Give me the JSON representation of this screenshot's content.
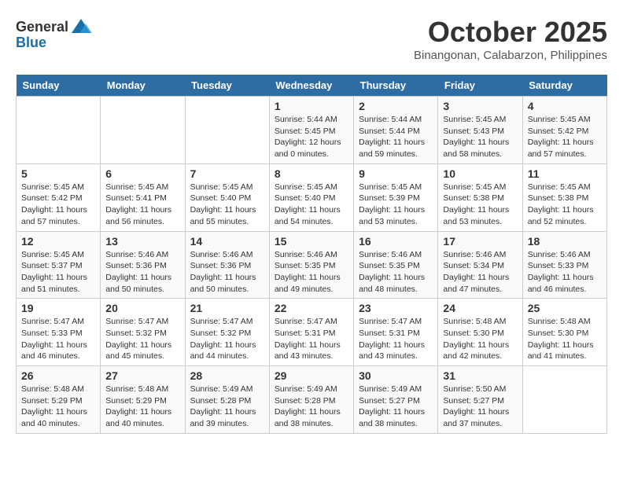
{
  "header": {
    "logo_general": "General",
    "logo_blue": "Blue",
    "month": "October 2025",
    "location": "Binangonan, Calabarzon, Philippines"
  },
  "days_of_week": [
    "Sunday",
    "Monday",
    "Tuesday",
    "Wednesday",
    "Thursday",
    "Friday",
    "Saturday"
  ],
  "weeks": [
    [
      {
        "day": "",
        "info": ""
      },
      {
        "day": "",
        "info": ""
      },
      {
        "day": "",
        "info": ""
      },
      {
        "day": "1",
        "info": "Sunrise: 5:44 AM\nSunset: 5:45 PM\nDaylight: 12 hours\nand 0 minutes."
      },
      {
        "day": "2",
        "info": "Sunrise: 5:44 AM\nSunset: 5:44 PM\nDaylight: 11 hours\nand 59 minutes."
      },
      {
        "day": "3",
        "info": "Sunrise: 5:45 AM\nSunset: 5:43 PM\nDaylight: 11 hours\nand 58 minutes."
      },
      {
        "day": "4",
        "info": "Sunrise: 5:45 AM\nSunset: 5:42 PM\nDaylight: 11 hours\nand 57 minutes."
      }
    ],
    [
      {
        "day": "5",
        "info": "Sunrise: 5:45 AM\nSunset: 5:42 PM\nDaylight: 11 hours\nand 57 minutes."
      },
      {
        "day": "6",
        "info": "Sunrise: 5:45 AM\nSunset: 5:41 PM\nDaylight: 11 hours\nand 56 minutes."
      },
      {
        "day": "7",
        "info": "Sunrise: 5:45 AM\nSunset: 5:40 PM\nDaylight: 11 hours\nand 55 minutes."
      },
      {
        "day": "8",
        "info": "Sunrise: 5:45 AM\nSunset: 5:40 PM\nDaylight: 11 hours\nand 54 minutes."
      },
      {
        "day": "9",
        "info": "Sunrise: 5:45 AM\nSunset: 5:39 PM\nDaylight: 11 hours\nand 53 minutes."
      },
      {
        "day": "10",
        "info": "Sunrise: 5:45 AM\nSunset: 5:38 PM\nDaylight: 11 hours\nand 53 minutes."
      },
      {
        "day": "11",
        "info": "Sunrise: 5:45 AM\nSunset: 5:38 PM\nDaylight: 11 hours\nand 52 minutes."
      }
    ],
    [
      {
        "day": "12",
        "info": "Sunrise: 5:45 AM\nSunset: 5:37 PM\nDaylight: 11 hours\nand 51 minutes."
      },
      {
        "day": "13",
        "info": "Sunrise: 5:46 AM\nSunset: 5:36 PM\nDaylight: 11 hours\nand 50 minutes."
      },
      {
        "day": "14",
        "info": "Sunrise: 5:46 AM\nSunset: 5:36 PM\nDaylight: 11 hours\nand 50 minutes."
      },
      {
        "day": "15",
        "info": "Sunrise: 5:46 AM\nSunset: 5:35 PM\nDaylight: 11 hours\nand 49 minutes."
      },
      {
        "day": "16",
        "info": "Sunrise: 5:46 AM\nSunset: 5:35 PM\nDaylight: 11 hours\nand 48 minutes."
      },
      {
        "day": "17",
        "info": "Sunrise: 5:46 AM\nSunset: 5:34 PM\nDaylight: 11 hours\nand 47 minutes."
      },
      {
        "day": "18",
        "info": "Sunrise: 5:46 AM\nSunset: 5:33 PM\nDaylight: 11 hours\nand 46 minutes."
      }
    ],
    [
      {
        "day": "19",
        "info": "Sunrise: 5:47 AM\nSunset: 5:33 PM\nDaylight: 11 hours\nand 46 minutes."
      },
      {
        "day": "20",
        "info": "Sunrise: 5:47 AM\nSunset: 5:32 PM\nDaylight: 11 hours\nand 45 minutes."
      },
      {
        "day": "21",
        "info": "Sunrise: 5:47 AM\nSunset: 5:32 PM\nDaylight: 11 hours\nand 44 minutes."
      },
      {
        "day": "22",
        "info": "Sunrise: 5:47 AM\nSunset: 5:31 PM\nDaylight: 11 hours\nand 43 minutes."
      },
      {
        "day": "23",
        "info": "Sunrise: 5:47 AM\nSunset: 5:31 PM\nDaylight: 11 hours\nand 43 minutes."
      },
      {
        "day": "24",
        "info": "Sunrise: 5:48 AM\nSunset: 5:30 PM\nDaylight: 11 hours\nand 42 minutes."
      },
      {
        "day": "25",
        "info": "Sunrise: 5:48 AM\nSunset: 5:30 PM\nDaylight: 11 hours\nand 41 minutes."
      }
    ],
    [
      {
        "day": "26",
        "info": "Sunrise: 5:48 AM\nSunset: 5:29 PM\nDaylight: 11 hours\nand 40 minutes."
      },
      {
        "day": "27",
        "info": "Sunrise: 5:48 AM\nSunset: 5:29 PM\nDaylight: 11 hours\nand 40 minutes."
      },
      {
        "day": "28",
        "info": "Sunrise: 5:49 AM\nSunset: 5:28 PM\nDaylight: 11 hours\nand 39 minutes."
      },
      {
        "day": "29",
        "info": "Sunrise: 5:49 AM\nSunset: 5:28 PM\nDaylight: 11 hours\nand 38 minutes."
      },
      {
        "day": "30",
        "info": "Sunrise: 5:49 AM\nSunset: 5:27 PM\nDaylight: 11 hours\nand 38 minutes."
      },
      {
        "day": "31",
        "info": "Sunrise: 5:50 AM\nSunset: 5:27 PM\nDaylight: 11 hours\nand 37 minutes."
      },
      {
        "day": "",
        "info": ""
      }
    ]
  ]
}
